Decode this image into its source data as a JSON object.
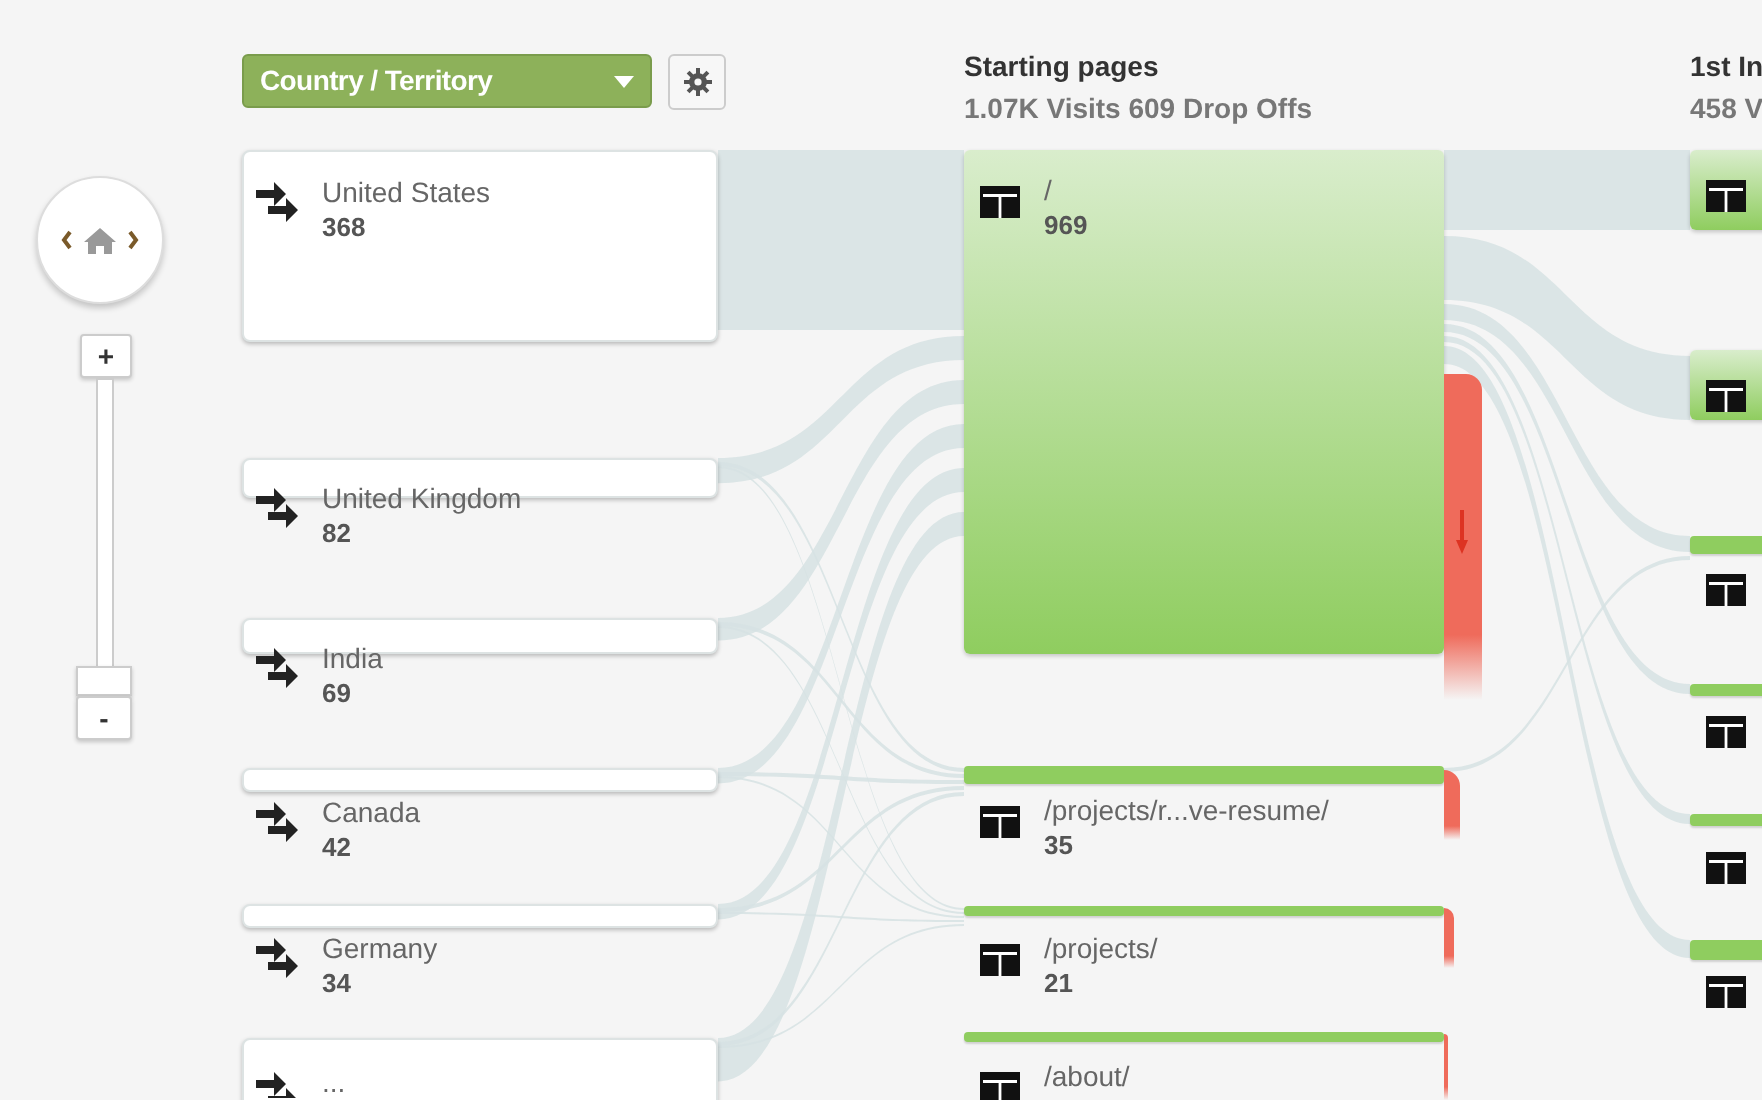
{
  "dimension_selector": {
    "label": "Country / Territory"
  },
  "zoom_controls": {
    "zoom_in": "+",
    "zoom_out": "-"
  },
  "countries": [
    {
      "name": "United States",
      "visits": "368"
    },
    {
      "name": "United Kingdom",
      "visits": "82"
    },
    {
      "name": "India",
      "visits": "69"
    },
    {
      "name": "Canada",
      "visits": "42"
    },
    {
      "name": "Germany",
      "visits": "34"
    },
    {
      "name": "..."
    }
  ],
  "starting_pages": {
    "title": "Starting pages",
    "summary": "1.07K Visits 609 Drop Offs",
    "pages": [
      {
        "path": "/",
        "visits": "969"
      },
      {
        "path": "/projects/r...ve-resume/",
        "visits": "35"
      },
      {
        "path": "/projects/",
        "visits": "21"
      },
      {
        "path": "/about/"
      }
    ]
  },
  "first_interaction": {
    "title": "1st In",
    "summary": "458 V"
  }
}
